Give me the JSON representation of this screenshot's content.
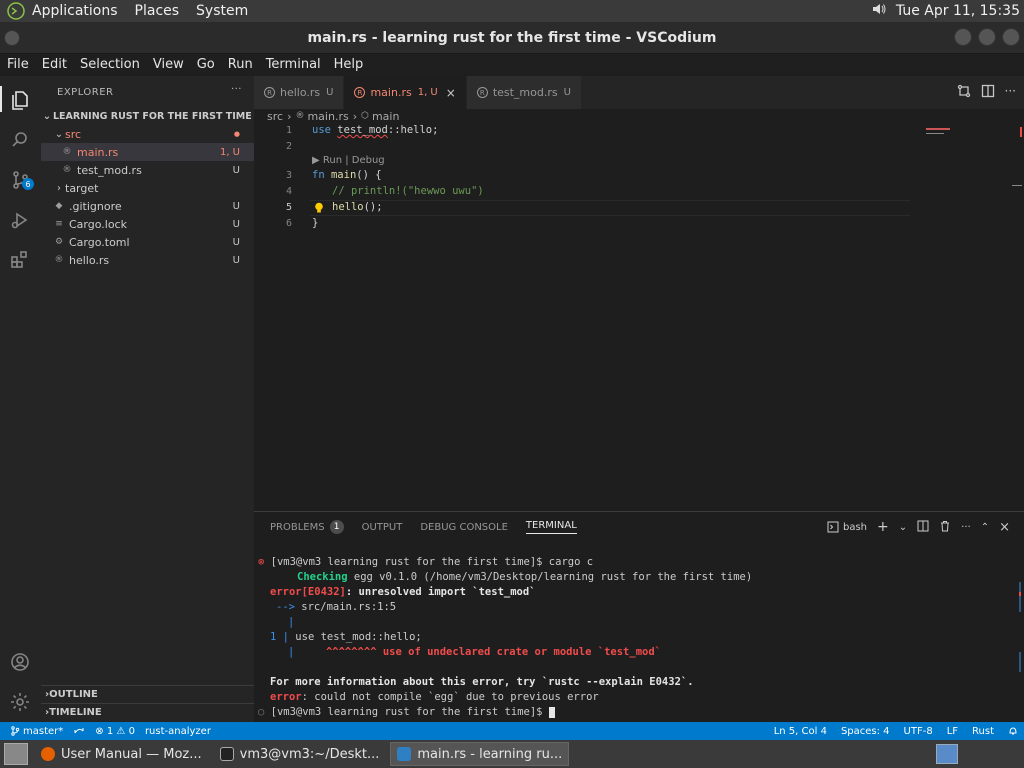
{
  "top_panel": {
    "menus": [
      "Applications",
      "Places",
      "System"
    ],
    "clock": "Tue Apr 11, 15:35"
  },
  "window": {
    "title": "main.rs - learning rust for the first time - VSCodium"
  },
  "menubar": [
    "File",
    "Edit",
    "Selection",
    "View",
    "Go",
    "Run",
    "Terminal",
    "Help"
  ],
  "activity_bar": {
    "scm_badge": "6"
  },
  "sidebar": {
    "title": "EXPLORER",
    "more": "···",
    "project": "LEARNING RUST FOR THE FIRST TIME",
    "items": [
      {
        "label": "src",
        "status": "●"
      },
      {
        "label": "main.rs",
        "status": "1, U"
      },
      {
        "label": "test_mod.rs",
        "status": "U"
      },
      {
        "label": "target",
        "status": ""
      },
      {
        "label": ".gitignore",
        "status": "U"
      },
      {
        "label": "Cargo.lock",
        "status": "U"
      },
      {
        "label": "Cargo.toml",
        "status": "U"
      },
      {
        "label": "hello.rs",
        "status": "U"
      }
    ],
    "outline": "OUTLINE",
    "timeline": "TIMELINE"
  },
  "tabs": [
    {
      "label": "hello.rs",
      "mod": "U"
    },
    {
      "label": "main.rs",
      "mod": "1, U",
      "close": "×"
    },
    {
      "label": "test_mod.rs",
      "mod": "U"
    }
  ],
  "breadcrumb": {
    "folder": "src",
    "file": "main.rs",
    "symbol": "main",
    "sep": "›"
  },
  "editor": {
    "line_numbers": [
      "1",
      "2",
      "3",
      "4",
      "5",
      "6"
    ],
    "line1_kw": "use",
    "line1_mod": "test_mod",
    "line1_rest": "::hello;",
    "codelens": "▶ Run | Debug",
    "line3_kw": "fn",
    "line3_fn": "main",
    "line3_rest": "() {",
    "line4": "// println!(\"hewwo uwu\")",
    "line5_fn": "hello",
    "line5_rest": "();",
    "line6": "}"
  },
  "panel": {
    "tabs": [
      "PROBLEMS",
      "OUTPUT",
      "DEBUG CONSOLE",
      "TERMINAL"
    ],
    "problems_count": "1",
    "shell": "bash",
    "terminal": {
      "dot": "⊗",
      "prompt1": "[vm3@vm3 learning rust for the first time]$ cargo c",
      "checking_word": "Checking",
      "checking_rest": " egg v0.1.0 (/home/vm3/Desktop/learning rust for the first time)",
      "error_code": "error[E0432]",
      "error_msg": ": unresolved import `test_mod`",
      "arrow": "-->",
      "location": " src/main.rs:1:5",
      "pipe": "|",
      "src_line_no": "1",
      "src_line": " use test_mod::hello;",
      "carets": "^^^^^^^^ use of undeclared crate or module `test_mod`",
      "more_info": "For more information about this error, try `rustc --explain E0432`.",
      "error_word": "error",
      "compile_err": ": could not compile `egg` due to previous error",
      "circle": "○",
      "prompt2": "[vm3@vm3 learning rust for the first time]$ "
    }
  },
  "statusbar": {
    "branch": "master*",
    "errors": "1",
    "warnings": "0",
    "analyzer": "rust-analyzer",
    "position": "Ln 5, Col 4",
    "spaces": "Spaces: 4",
    "encoding": "UTF-8",
    "eol": "LF",
    "language": "Rust"
  },
  "taskbar": [
    {
      "label": "User Manual — Moz..."
    },
    {
      "label": "vm3@vm3:~/Deskt..."
    },
    {
      "label": "main.rs - learning ru..."
    }
  ]
}
